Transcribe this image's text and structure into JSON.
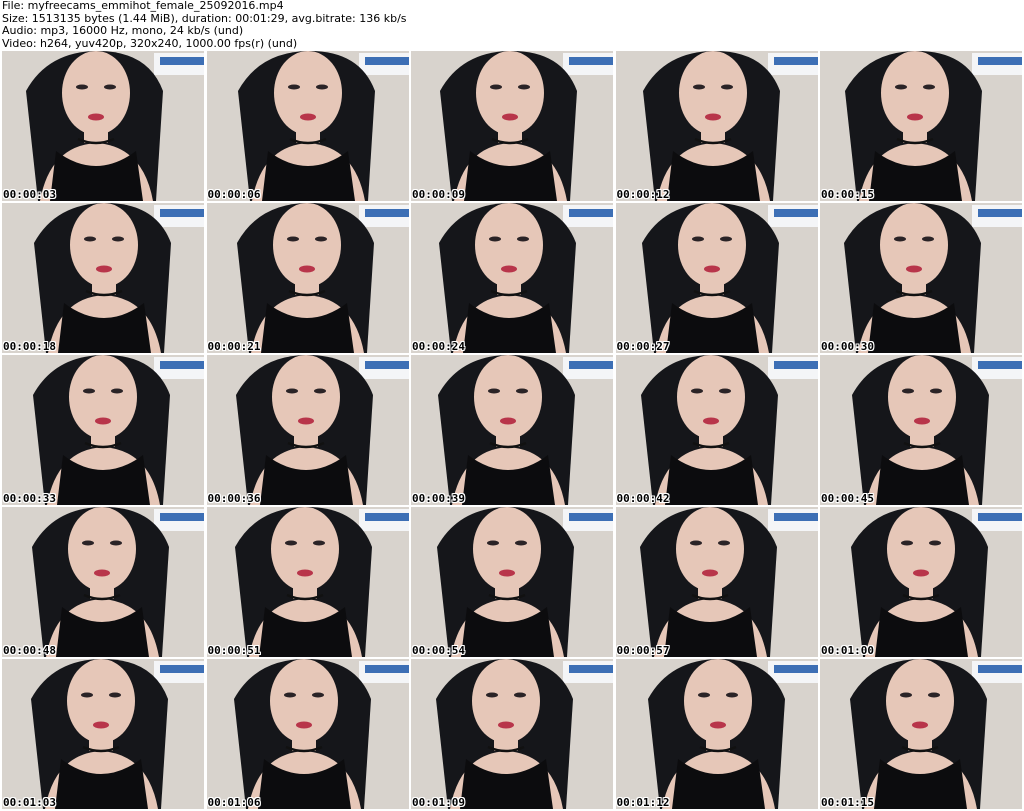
{
  "header": {
    "file_line": "File: myfreecams_emmihot_female_25092016.mp4",
    "size_line": "Size: 1513135 bytes (1.44 MiB), duration: 00:01:29, avg.bitrate: 136 kb/s",
    "audio_line": "Audio: mp3, 16000 Hz, mono, 24 kb/s (und)",
    "video_line": "Video: h264, yuv420p, 320x240, 1000.00 fps(r) (und)"
  },
  "thumbnails": [
    {
      "timestamp": "00:00:03"
    },
    {
      "timestamp": "00:00:06"
    },
    {
      "timestamp": "00:00:09"
    },
    {
      "timestamp": "00:00:12"
    },
    {
      "timestamp": "00:00:15"
    },
    {
      "timestamp": "00:00:18"
    },
    {
      "timestamp": "00:00:21"
    },
    {
      "timestamp": "00:00:24"
    },
    {
      "timestamp": "00:00:27"
    },
    {
      "timestamp": "00:00:30"
    },
    {
      "timestamp": "00:00:33"
    },
    {
      "timestamp": "00:00:36"
    },
    {
      "timestamp": "00:00:39"
    },
    {
      "timestamp": "00:00:42"
    },
    {
      "timestamp": "00:00:45"
    },
    {
      "timestamp": "00:00:48"
    },
    {
      "timestamp": "00:00:51"
    },
    {
      "timestamp": "00:00:54"
    },
    {
      "timestamp": "00:00:57"
    },
    {
      "timestamp": "00:01:00"
    },
    {
      "timestamp": "00:01:03"
    },
    {
      "timestamp": "00:01:06"
    },
    {
      "timestamp": "00:01:09"
    },
    {
      "timestamp": "00:01:12"
    },
    {
      "timestamp": "00:01:15"
    }
  ],
  "colors": {
    "wall": "#d8d3cd",
    "hair": "#15161a",
    "skin": "#e6c7b8",
    "lips": "#b8354a",
    "top": "#0c0c0e",
    "ac_unit": "#f4f5f7",
    "ac_stripe": "#3d6fb5"
  }
}
